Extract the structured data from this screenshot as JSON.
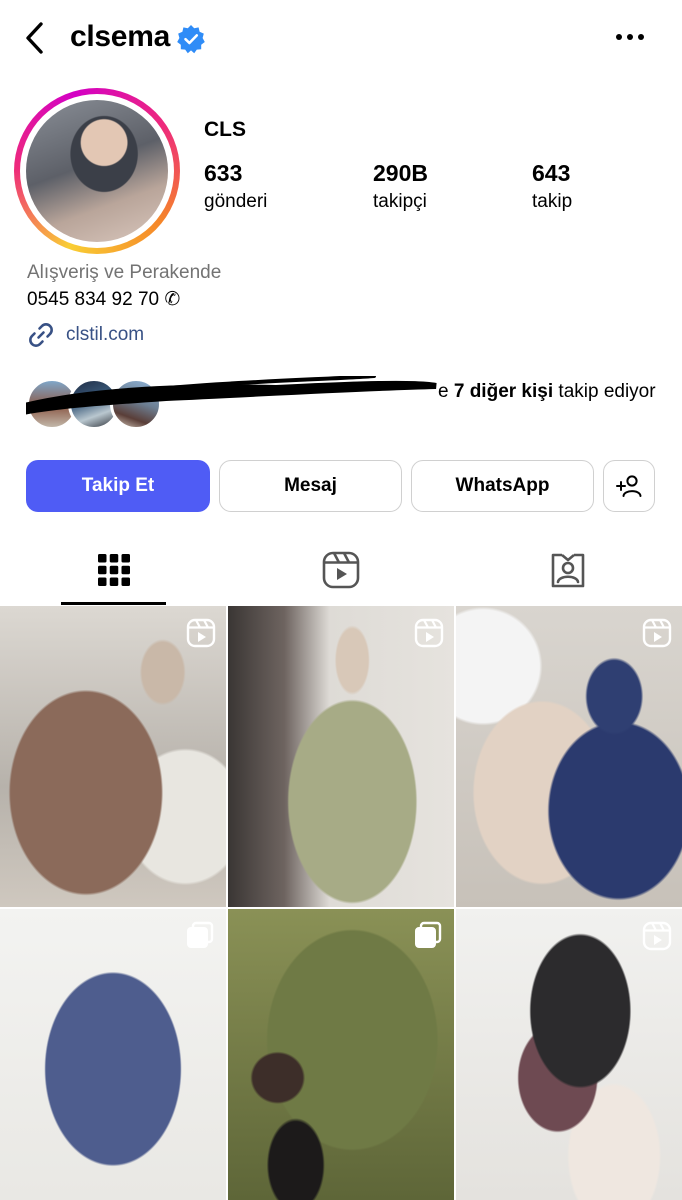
{
  "header": {
    "username": "clsema"
  },
  "profile": {
    "display_name": "CLS",
    "stats": [
      {
        "value": "633",
        "label": "gönderi"
      },
      {
        "value": "290B",
        "label": "takipçi"
      },
      {
        "value": "643",
        "label": "takip"
      }
    ],
    "category": "Alışveriş ve Perakende",
    "phone": "0545 834 92 70 ✆",
    "link": "clstil.com",
    "followed_by_suffix": "e",
    "followed_by_bold": "7 diğer kişi",
    "followed_by_after": " takip ediyor"
  },
  "actions": {
    "follow_label": "Takip Et",
    "message_label": "Mesaj",
    "whatsapp_label": "WhatsApp"
  },
  "colors": {
    "primary_button": "#4f5cf5",
    "link": "#385185",
    "verified": "#2f8cf7"
  },
  "tabs": [
    {
      "icon": "grid-icon",
      "active": true
    },
    {
      "icon": "reels-icon",
      "active": false
    },
    {
      "icon": "tagged-icon",
      "active": false
    }
  ],
  "posts": [
    {
      "type": "reel",
      "desc": "brown floral dress held up"
    },
    {
      "type": "reel",
      "desc": "olive green dress"
    },
    {
      "type": "reel",
      "desc": "beige and navy dresses"
    },
    {
      "type": "carousel",
      "desc": "navy blue dress on hanger"
    },
    {
      "type": "carousel",
      "desc": "green floral dress flat lay"
    },
    {
      "type": "reel",
      "desc": "folded floral fabrics"
    }
  ]
}
